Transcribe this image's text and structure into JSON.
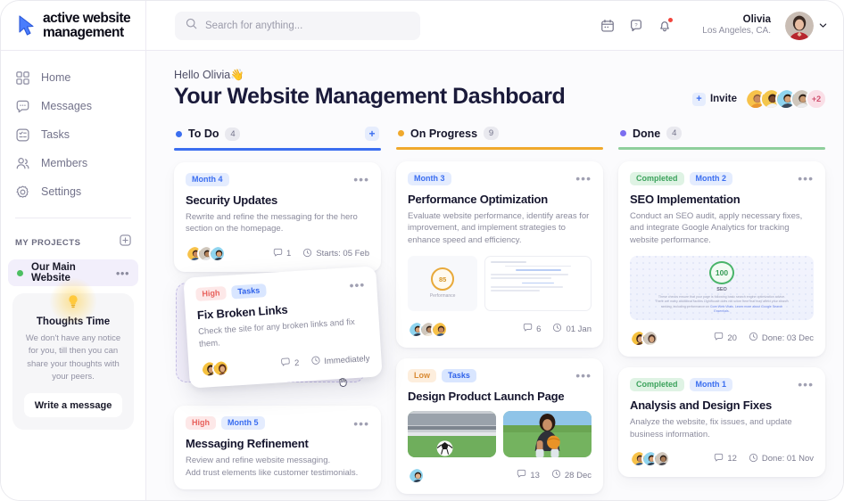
{
  "brand": {
    "line1": "active website",
    "line2": "management",
    "logo_icon": "cursor-arrow-icon"
  },
  "search": {
    "placeholder": "Search for anything...",
    "value": "",
    "icon": "search-icon"
  },
  "header": {
    "calendar_icon": "calendar-icon",
    "help_icon": "help-chat-icon",
    "bell_icon": "notification-bell-icon",
    "user_name": "Olivia",
    "user_location": "Los Angeles, CA.",
    "chevron_icon": "chevron-down-icon"
  },
  "sidebar": {
    "items": [
      {
        "label": "Home",
        "icon": "grid-home-icon"
      },
      {
        "label": "Messages",
        "icon": "message-bubble-icon"
      },
      {
        "label": "Tasks",
        "icon": "checklist-tasks-icon"
      },
      {
        "label": "Members",
        "icon": "members-people-icon"
      },
      {
        "label": "Settings",
        "icon": "gear-settings-icon"
      }
    ],
    "projects_title": "MY PROJECTS",
    "projects_add_icon": "plus-square-icon",
    "projects": [
      {
        "name": "Our Main Website",
        "dot_color": "#4dbf62",
        "menu_icon": "more-dots-icon"
      }
    ],
    "thoughts": {
      "icon": "lightbulb-icon",
      "title": "Thoughts Time",
      "body": "We don't have any notice for you, till then you can share your thoughts with your peers.",
      "button_label": "Write a message"
    }
  },
  "main": {
    "greeting": "Hello Olivia",
    "greeting_emoji": "👋",
    "title": "Your Website Management Dashboard",
    "invite_label": "Invite",
    "invite_plus_icon": "plus-icon",
    "avatars_overflow": "+2"
  },
  "colors": {
    "todo": "#3b6ef0",
    "progress": "#f0a92c",
    "done_dot": "#7b6ef0",
    "done_rule": "#8fcf9c",
    "accent": "#3b6ef0",
    "sidebar_active_bg": "#f2effb"
  },
  "board": {
    "columns": [
      {
        "title": "To Do",
        "count": "4",
        "dot_color": "#3b6ef0",
        "rule_color": "#3b6ef0",
        "has_add": true,
        "add_icon": "plus-icon",
        "cards": [
          {
            "tags": [
              {
                "label": "Month 4",
                "style": "tag-month"
              }
            ],
            "title": "Security Updates",
            "desc": "Rewrite and refine the messaging for the hero section on the homepage.",
            "avatars": 3,
            "comments": "1",
            "date": "Starts: 05 Feb",
            "menu_icon": "more-dots-icon",
            "comment_icon": "comment-icon",
            "clock_icon": "clock-icon"
          },
          {
            "tags": [
              {
                "label": "High",
                "style": "tag-high"
              },
              {
                "label": "Month 5",
                "style": "tag-month"
              }
            ],
            "title": "Messaging Refinement",
            "desc": "Review and refine website messaging.\nAdd trust elements like customer testimonials.",
            "menu_icon": "more-dots-icon"
          }
        ],
        "dragging_card": {
          "tags": [
            {
              "label": "High",
              "style": "tag-high"
            },
            {
              "label": "Tasks",
              "style": "tag-tasks"
            }
          ],
          "title": "Fix Broken Links",
          "desc": "Check the site for any broken links and fix them.",
          "avatars": 2,
          "comments": "2",
          "date": "Immediately",
          "menu_icon": "more-dots-icon",
          "comment_icon": "comment-icon",
          "clock_icon": "clock-icon",
          "cursor_icon": "grabbing-hand-icon"
        }
      },
      {
        "title": "On Progress",
        "count": "9",
        "dot_color": "#f0a92c",
        "rule_color": "#f0a92c",
        "has_add": false,
        "cards": [
          {
            "tags": [
              {
                "label": "Month 3",
                "style": "tag-month"
              }
            ],
            "title": "Performance Optimization",
            "desc": "Evaluate website performance, identify areas for improvement, and implement strategies to enhance speed and efficiency.",
            "attachment": "performance-report",
            "gauge_value": "85",
            "gauge_label": "Performance",
            "avatars": 3,
            "comments": "6",
            "date": "01 Jan",
            "menu_icon": "more-dots-icon",
            "comment_icon": "comment-icon",
            "clock_icon": "clock-icon"
          },
          {
            "tags": [
              {
                "label": "Low",
                "style": "tag-low"
              },
              {
                "label": "Tasks",
                "style": "tag-tasks"
              }
            ],
            "title": "Design Product Launch Page",
            "attachment": "photos",
            "avatars": 1,
            "comments": "13",
            "date": "28 Dec",
            "menu_icon": "more-dots-icon",
            "comment_icon": "comment-icon",
            "clock_icon": "clock-icon"
          }
        ]
      },
      {
        "title": "Done",
        "count": "4",
        "dot_color": "#7b6ef0",
        "rule_color": "#8fcf9c",
        "has_add": false,
        "cards": [
          {
            "tags": [
              {
                "label": "Completed",
                "style": "tag-completed"
              },
              {
                "label": "Month 2",
                "style": "tag-month"
              }
            ],
            "title": "SEO Implementation",
            "desc": "Conduct an SEO audit, apply necessary fixes, and integrate Google Analytics for tracking website performance.",
            "attachment": "seo-report",
            "gauge_value": "100",
            "gauge_label": "SEO",
            "seo_text": "These checks ensure that your page is following basic search engine optimization advice. There are many additional factors Lighthouse does not score here that may affect your search ranking, including performance on ",
            "seo_link": "Core Web Vitals. Learn more about Google Search Essentials.",
            "avatars": 2,
            "comments": "20",
            "date": "Done: 03 Dec",
            "menu_icon": "more-dots-icon",
            "comment_icon": "comment-icon",
            "clock_icon": "clock-icon"
          },
          {
            "tags": [
              {
                "label": "Completed",
                "style": "tag-completed"
              },
              {
                "label": "Month 1",
                "style": "tag-month"
              }
            ],
            "title": "Analysis and Design Fixes",
            "desc": "Analyze the website, fix issues, and update business information.",
            "avatars": 3,
            "comments": "12",
            "date": "Done: 01 Nov",
            "menu_icon": "more-dots-icon",
            "comment_icon": "comment-icon",
            "clock_icon": "clock-icon"
          }
        ]
      }
    ]
  }
}
